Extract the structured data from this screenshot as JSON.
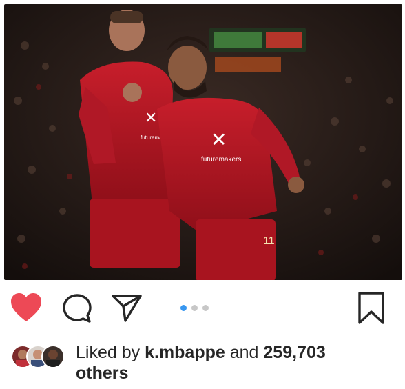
{
  "post": {
    "image_description_icon": "photo-icon",
    "carousel": {
      "count": 3,
      "active_index": 0
    },
    "colors": {
      "like_red": "#ed4956",
      "dot_active": "#3897f0",
      "dot_inactive": "#c7c7c7",
      "text": "#262626"
    }
  },
  "actions": {
    "like_icon": "heart-icon",
    "comment_icon": "comment-icon",
    "share_icon": "share-icon",
    "bookmark_icon": "bookmark-icon"
  },
  "likes": {
    "prefix": "Liked by",
    "user": "k.mbappe",
    "connector": "and",
    "count": "259,703",
    "suffix": "others"
  }
}
